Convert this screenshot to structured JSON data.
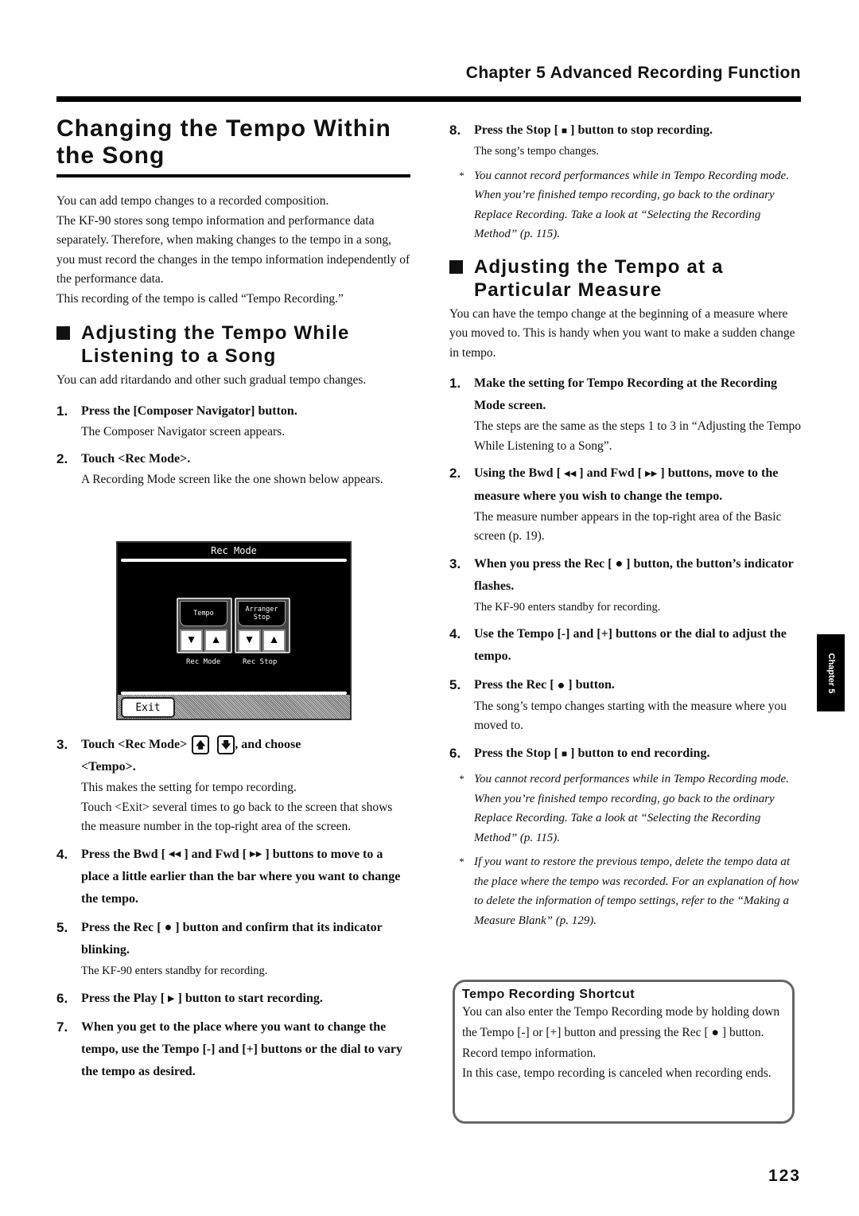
{
  "header": {
    "chapter_title": "Chapter 5 Advanced Recording Function"
  },
  "left": {
    "title_line1": "Changing the Tempo Within",
    "title_line2": "the Song",
    "intro": [
      "You can add tempo changes to a recorded composition.",
      "The KF-90 stores song tempo information and performance data separately. Therefore, when making changes to the tempo in a song, you must record the changes in the tempo information independently of the performance data.",
      "This recording of the tempo is called “Tempo Recording.”"
    ],
    "section1": {
      "heading_line1": "Adjusting the Tempo While",
      "heading_line2": "Listening to a Song",
      "intro": "You can add ritardando and other such gradual tempo changes.",
      "steps": [
        {
          "num": "1.",
          "text": "Press the [Composer Navigator] button.",
          "sub": "The Composer Navigator screen appears."
        },
        {
          "num": "2.",
          "text": "Touch <Rec Mode>.",
          "sub": "A Recording Mode screen like the one shown below appears."
        },
        {
          "num": "3.",
          "text_a": "Touch <Rec Mode>",
          "text_b": ", and choose",
          "text_c": "<Tempo>.",
          "sub1": "This makes the setting for tempo recording.",
          "sub2": "Touch <Exit> several times to go back to the screen that shows the measure number in the top-right area of the screen."
        },
        {
          "num": "4.",
          "text_a": "Press the Bwd [",
          "text_b": "] and Fwd [",
          "text_c": "] buttons to move to a place a little earlier than the bar where you want to change the tempo."
        },
        {
          "num": "5.",
          "text_a": "Press the Rec [",
          "text_b": "] button and confirm that its indicator blinking.",
          "sub": "The KF-90 enters standby for recording."
        },
        {
          "num": "6.",
          "text_a": "Press the Play [",
          "text_b": "] button to start recording."
        },
        {
          "num": "7.",
          "text": "When you get to the place where you want to change the tempo, use the Tempo [-] and [+] buttons or the dial to vary the tempo as desired."
        }
      ]
    }
  },
  "screen": {
    "title": "Rec Mode",
    "param1_value": "Tempo",
    "param1_caption": "Rec Mode",
    "param2_value_line1": "Arranger",
    "param2_value_line2": "Stop",
    "param2_caption": "Rec Stop",
    "exit_label": "Exit",
    "down_icon": "▼",
    "up_icon": "▲"
  },
  "right": {
    "step8": {
      "num": "8.",
      "text_a": "Press the Stop [",
      "text_b": "] button to stop recording.",
      "sub": "The song’s tempo changes."
    },
    "note1": "You cannot record performances while in Tempo Recording mode. When you’re finished tempo recording, go back to the ordinary Replace Recording. Take a look at “Selecting the Recording Method” (p. 115).",
    "section2": {
      "heading_line1": "Adjusting the Tempo at a",
      "heading_line2": "Particular Measure",
      "intro": "You can have the tempo change at the beginning of a measure where you moved to. This is handy when you want to make a sudden change in tempo.",
      "steps": [
        {
          "num": "1.",
          "text": "Make the setting for Tempo Recording at the Recording Mode screen.",
          "sub": "The steps are the same as the steps 1 to 3 in “Adjusting the Tempo While Listening to a Song”."
        },
        {
          "num": "2.",
          "text_a": "Using the Bwd [",
          "text_b": "] and Fwd [",
          "text_c": "] buttons, move to the measure where you wish to change the tempo.",
          "sub": "The measure number appears in the top-right area of the Basic screen (p. 19)."
        },
        {
          "num": "3.",
          "text_a": "When you press the Rec [",
          "text_b": "] button, the button’s indicator flashes.",
          "sub": "The KF-90 enters standby for recording."
        },
        {
          "num": "4.",
          "text": "Use the Tempo [-] and [+] buttons or the dial to adjust the tempo."
        },
        {
          "num": "5.",
          "text_a": "Press the Rec [",
          "text_b": "] button.",
          "sub": "The song’s tempo changes starting with the measure where you moved to."
        },
        {
          "num": "6.",
          "text_a": "Press the Stop [",
          "text_b": "] button to end recording."
        }
      ],
      "notes": [
        "You cannot record performances while in Tempo Recording mode. When you’re finished tempo recording, go back to the ordinary Replace Recording. Take a look at “Selecting the Recording Method” (p. 115).",
        "If you want to restore the previous tempo, delete the tempo data at the place where the tempo was recorded. For an explanation of how to delete the information of tempo settings, refer to the “Making a Measure Blank” (p. 129)."
      ]
    },
    "shortcut": {
      "title": "Tempo Recording Shortcut",
      "line1": "You can also enter the Tempo Recording mode by holding down the Tempo [-] or [+] button and pressing the Rec [",
      "line1_end": "] button.",
      "line2": "Record tempo information.",
      "line3": "In this case, tempo recording is canceled when recording ends."
    }
  },
  "glyphs": {
    "rec": "●",
    "stop": "■",
    "play": "▶",
    "bwd": "◀◀",
    "fwd": "▶▶",
    "up": "🡅",
    "down": "🡇",
    "asterisk": "*"
  },
  "side_tab": "Chapter 5",
  "page_number": "123"
}
